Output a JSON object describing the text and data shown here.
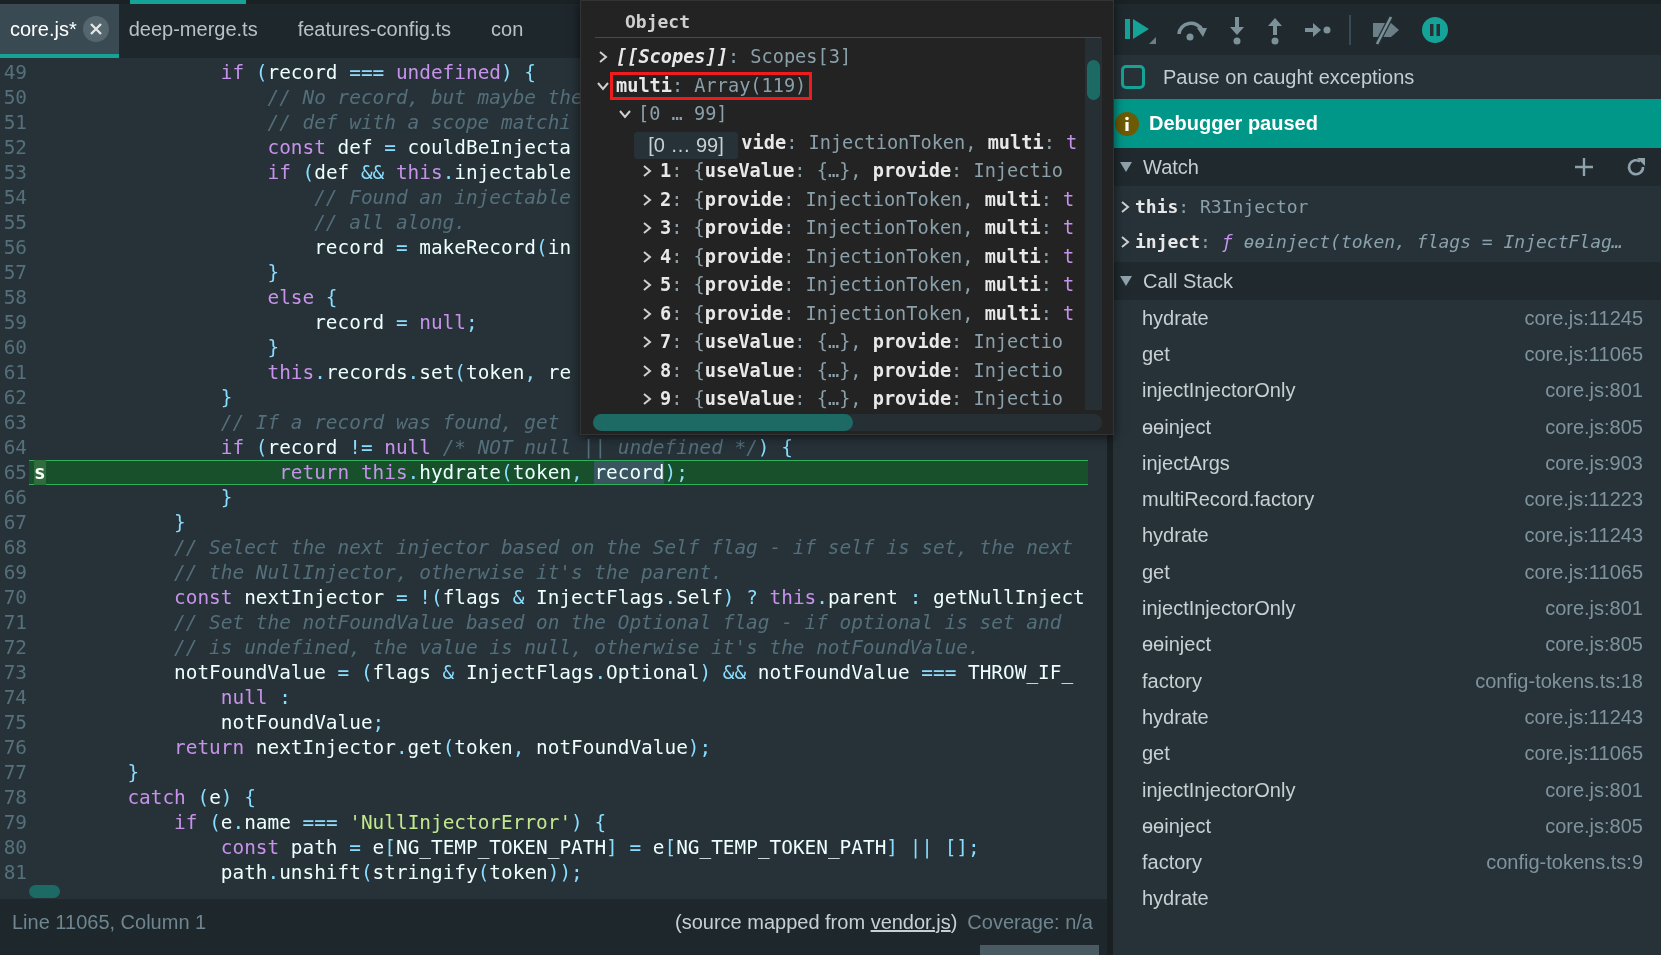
{
  "tabs": [
    {
      "label": "core.js*",
      "selected": true,
      "closable": true
    },
    {
      "label": "deep-merge.ts",
      "selected": false,
      "closable": false
    },
    {
      "label": "features-config.ts",
      "selected": false,
      "closable": false
    },
    {
      "label": "con",
      "selected": false,
      "closable": false
    }
  ],
  "editor": {
    "lines": [
      {
        "number": "49",
        "current": false,
        "segments": [
          {
            "t": "                if",
            "kind": "k"
          },
          {
            "t": " (",
            "kind": "o"
          },
          {
            "t": "record",
            "kind": "p"
          },
          {
            "t": " === ",
            "kind": "o"
          },
          {
            "t": "undefined",
            "kind": "k"
          },
          {
            "t": ") {",
            "kind": "o"
          }
        ]
      },
      {
        "number": "50",
        "current": false,
        "segments": [
          {
            "t": "                    // No record, but maybe the",
            "kind": "c"
          }
        ]
      },
      {
        "number": "51",
        "current": false,
        "segments": [
          {
            "t": "                    // def with a scope matchi",
            "kind": "c"
          }
        ]
      },
      {
        "number": "52",
        "current": false,
        "segments": [
          {
            "t": "                    const",
            "kind": "k"
          },
          {
            "t": " def ",
            "kind": "p"
          },
          {
            "t": "=",
            "kind": "o"
          },
          {
            "t": " couldBeInjecta",
            "kind": "p"
          }
        ]
      },
      {
        "number": "53",
        "current": false,
        "segments": [
          {
            "t": "                    if",
            "kind": "k"
          },
          {
            "t": " (",
            "kind": "o"
          },
          {
            "t": "def ",
            "kind": "p"
          },
          {
            "t": "&&",
            "kind": "o"
          },
          {
            "t": " this",
            "kind": "k"
          },
          {
            "t": ".",
            "kind": "o"
          },
          {
            "t": "injectable",
            "kind": "p"
          }
        ]
      },
      {
        "number": "54",
        "current": false,
        "segments": [
          {
            "t": "                        // Found an injectable",
            "kind": "c"
          }
        ]
      },
      {
        "number": "55",
        "current": false,
        "segments": [
          {
            "t": "                        // all along.",
            "kind": "c"
          }
        ]
      },
      {
        "number": "56",
        "current": false,
        "segments": [
          {
            "t": "                        record ",
            "kind": "p"
          },
          {
            "t": "=",
            "kind": "o"
          },
          {
            "t": " makeRecord",
            "kind": "p"
          },
          {
            "t": "(",
            "kind": "o"
          },
          {
            "t": "in",
            "kind": "p"
          }
        ]
      },
      {
        "number": "57",
        "current": false,
        "segments": [
          {
            "t": "                    }",
            "kind": "o"
          }
        ]
      },
      {
        "number": "58",
        "current": false,
        "segments": [
          {
            "t": "                    else",
            "kind": "k"
          },
          {
            "t": " {",
            "kind": "o"
          }
        ]
      },
      {
        "number": "59",
        "current": false,
        "segments": [
          {
            "t": "                        record ",
            "kind": "p"
          },
          {
            "t": "=",
            "kind": "o"
          },
          {
            "t": " null",
            "kind": "k"
          },
          {
            "t": ";",
            "kind": "o"
          }
        ]
      },
      {
        "number": "60",
        "current": false,
        "segments": [
          {
            "t": "                    }",
            "kind": "o"
          }
        ]
      },
      {
        "number": "61",
        "current": false,
        "segments": [
          {
            "t": "                    this",
            "kind": "k"
          },
          {
            "t": ".",
            "kind": "o"
          },
          {
            "t": "records",
            "kind": "p"
          },
          {
            "t": ".",
            "kind": "o"
          },
          {
            "t": "set",
            "kind": "p"
          },
          {
            "t": "(",
            "kind": "o"
          },
          {
            "t": "token",
            "kind": "p"
          },
          {
            "t": ", ",
            "kind": "o"
          },
          {
            "t": "re",
            "kind": "p"
          }
        ]
      },
      {
        "number": "62",
        "current": false,
        "segments": [
          {
            "t": "                }",
            "kind": "o"
          }
        ]
      },
      {
        "number": "63",
        "current": false,
        "segments": [
          {
            "t": "                // If a record was found, get",
            "kind": "c"
          }
        ]
      },
      {
        "number": "64",
        "current": false,
        "segments": [
          {
            "t": "                if",
            "kind": "k"
          },
          {
            "t": " (",
            "kind": "o"
          },
          {
            "t": "record ",
            "kind": "p"
          },
          {
            "t": "!=",
            "kind": "o"
          },
          {
            "t": " null",
            "kind": "k"
          },
          {
            "t": " /* NOT null || undefined */",
            "kind": "c"
          },
          {
            "t": ") {",
            "kind": "o"
          }
        ]
      },
      {
        "number": "65",
        "current": true,
        "marker": "s",
        "segments": [
          {
            "t": "                    return",
            "kind": "k"
          },
          {
            "t": " this",
            "kind": "k"
          },
          {
            "t": ".",
            "kind": "o"
          },
          {
            "t": "hydrate",
            "kind": "p"
          },
          {
            "t": "(",
            "kind": "o"
          },
          {
            "t": "token",
            "kind": "p"
          },
          {
            "t": ", ",
            "kind": "o"
          },
          {
            "t": "record",
            "kind": "sel"
          },
          {
            "t": ");",
            "kind": "o"
          }
        ]
      },
      {
        "number": "66",
        "current": false,
        "segments": [
          {
            "t": "                }",
            "kind": "o"
          }
        ]
      },
      {
        "number": "67",
        "current": false,
        "segments": [
          {
            "t": "            }",
            "kind": "o"
          }
        ]
      },
      {
        "number": "68",
        "current": false,
        "segments": [
          {
            "t": "            // Select the next injector based on the Self flag - if self is set, the next",
            "kind": "c"
          }
        ]
      },
      {
        "number": "69",
        "current": false,
        "segments": [
          {
            "t": "            // the NullInjector, otherwise it's the parent.",
            "kind": "c"
          }
        ]
      },
      {
        "number": "70",
        "current": false,
        "segments": [
          {
            "t": "            const",
            "kind": "k"
          },
          {
            "t": " nextInjector ",
            "kind": "p"
          },
          {
            "t": "= !(",
            "kind": "o"
          },
          {
            "t": "flags ",
            "kind": "p"
          },
          {
            "t": "&",
            "kind": "o"
          },
          {
            "t": " InjectFlags",
            "kind": "p"
          },
          {
            "t": ".",
            "kind": "o"
          },
          {
            "t": "Self",
            "kind": "p"
          },
          {
            "t": ") ? ",
            "kind": "o"
          },
          {
            "t": "this",
            "kind": "k"
          },
          {
            "t": ".",
            "kind": "o"
          },
          {
            "t": "parent ",
            "kind": "p"
          },
          {
            "t": ": ",
            "kind": "o"
          },
          {
            "t": "getNullInject",
            "kind": "p"
          }
        ]
      },
      {
        "number": "71",
        "current": false,
        "segments": [
          {
            "t": "            // Set the notFoundValue based on the Optional flag - if optional is set and",
            "kind": "c"
          }
        ]
      },
      {
        "number": "72",
        "current": false,
        "segments": [
          {
            "t": "            // is undefined, the value is null, otherwise it's the notFoundValue.",
            "kind": "c"
          }
        ]
      },
      {
        "number": "73",
        "current": false,
        "segments": [
          {
            "t": "            notFoundValue ",
            "kind": "p"
          },
          {
            "t": "= (",
            "kind": "o"
          },
          {
            "t": "flags ",
            "kind": "p"
          },
          {
            "t": "&",
            "kind": "o"
          },
          {
            "t": " InjectFlags",
            "kind": "p"
          },
          {
            "t": ".",
            "kind": "o"
          },
          {
            "t": "Optional",
            "kind": "p"
          },
          {
            "t": ") && ",
            "kind": "o"
          },
          {
            "t": "notFoundValue ",
            "kind": "p"
          },
          {
            "t": "===",
            "kind": "o"
          },
          {
            "t": " THROW_IF_",
            "kind": "p"
          }
        ]
      },
      {
        "number": "74",
        "current": false,
        "segments": [
          {
            "t": "                null",
            "kind": "k"
          },
          {
            "t": " :",
            "kind": "o"
          }
        ]
      },
      {
        "number": "75",
        "current": false,
        "segments": [
          {
            "t": "                notFoundValue",
            "kind": "p"
          },
          {
            "t": ";",
            "kind": "o"
          }
        ]
      },
      {
        "number": "76",
        "current": false,
        "segments": [
          {
            "t": "            return",
            "kind": "k"
          },
          {
            "t": " nextInjector",
            "kind": "p"
          },
          {
            "t": ".",
            "kind": "o"
          },
          {
            "t": "get",
            "kind": "p"
          },
          {
            "t": "(",
            "kind": "o"
          },
          {
            "t": "token",
            "kind": "p"
          },
          {
            "t": ", ",
            "kind": "o"
          },
          {
            "t": "notFoundValue",
            "kind": "p"
          },
          {
            "t": ");",
            "kind": "o"
          }
        ]
      },
      {
        "number": "77",
        "current": false,
        "segments": [
          {
            "t": "        }",
            "kind": "o"
          }
        ]
      },
      {
        "number": "78",
        "current": false,
        "segments": [
          {
            "t": "        catch",
            "kind": "k"
          },
          {
            "t": " (",
            "kind": "o"
          },
          {
            "t": "e",
            "kind": "p"
          },
          {
            "t": ") {",
            "kind": "o"
          }
        ]
      },
      {
        "number": "79",
        "current": false,
        "segments": [
          {
            "t": "            if",
            "kind": "k"
          },
          {
            "t": " (",
            "kind": "o"
          },
          {
            "t": "e",
            "kind": "p"
          },
          {
            "t": ".",
            "kind": "o"
          },
          {
            "t": "name ",
            "kind": "p"
          },
          {
            "t": "===",
            "kind": "o"
          },
          {
            "t": " 'NullInjectorError'",
            "kind": "s"
          },
          {
            "t": ") {",
            "kind": "o"
          }
        ]
      },
      {
        "number": "80",
        "current": false,
        "segments": [
          {
            "t": "                const",
            "kind": "k"
          },
          {
            "t": " path ",
            "kind": "p"
          },
          {
            "t": "=",
            "kind": "o"
          },
          {
            "t": " e",
            "kind": "p"
          },
          {
            "t": "[",
            "kind": "o"
          },
          {
            "t": "NG_TEMP_TOKEN_PATH",
            "kind": "p"
          },
          {
            "t": "] = ",
            "kind": "o"
          },
          {
            "t": "e",
            "kind": "p"
          },
          {
            "t": "[",
            "kind": "o"
          },
          {
            "t": "NG_TEMP_TOKEN_PATH",
            "kind": "p"
          },
          {
            "t": "] || [];",
            "kind": "o"
          }
        ]
      },
      {
        "number": "81",
        "current": false,
        "segments": [
          {
            "t": "                path",
            "kind": "p"
          },
          {
            "t": ".",
            "kind": "o"
          },
          {
            "t": "unshift",
            "kind": "p"
          },
          {
            "t": "(",
            "kind": "o"
          },
          {
            "t": "stringify",
            "kind": "p"
          },
          {
            "t": "(",
            "kind": "o"
          },
          {
            "t": "token",
            "kind": "p"
          },
          {
            "t": "));",
            "kind": "o"
          }
        ]
      }
    ]
  },
  "popup": {
    "title": "Object",
    "tooltip": "[0 … 99]",
    "tree": [
      {
        "kind": "entry",
        "expanded": false,
        "highlighted": false,
        "segments": [
          {
            "t": "[[Scopes]]",
            "kind": "ikey"
          },
          {
            "t": ": Scopes[3]",
            "kind": "val"
          }
        ]
      },
      {
        "kind": "entry",
        "expanded": true,
        "highlighted": true,
        "segments": [
          {
            "t": "multi",
            "kind": "key"
          },
          {
            "t": ": Array(119)",
            "kind": "val"
          }
        ],
        "children": [
          {
            "kind": "entry",
            "expanded": true,
            "highlighted": false,
            "segments": [
              {
                "t": "[0 … 99]",
                "kind": "val"
              }
            ],
            "children": [
              {
                "kind": "covered",
                "segments": [
                  {
                    "t": "vide",
                    "kind": "key"
                  },
                  {
                    "t": ": InjectionToken, ",
                    "kind": "val"
                  },
                  {
                    "t": "multi",
                    "kind": "key"
                  },
                  {
                    "t": ": ",
                    "kind": "val"
                  },
                  {
                    "t": "t",
                    "kind": "bool"
                  }
                ]
              },
              {
                "kind": "entry",
                "expanded": false,
                "segments": [
                  {
                    "t": "1",
                    "kind": "key"
                  },
                  {
                    "t": ": {",
                    "kind": "val"
                  },
                  {
                    "t": "useValue",
                    "kind": "key"
                  },
                  {
                    "t": ": {…}, ",
                    "kind": "val"
                  },
                  {
                    "t": "provide",
                    "kind": "key"
                  },
                  {
                    "t": ": Injectio",
                    "kind": "val"
                  }
                ]
              },
              {
                "kind": "entry",
                "expanded": false,
                "segments": [
                  {
                    "t": "2",
                    "kind": "key"
                  },
                  {
                    "t": ": {",
                    "kind": "val"
                  },
                  {
                    "t": "provide",
                    "kind": "key"
                  },
                  {
                    "t": ": InjectionToken, ",
                    "kind": "val"
                  },
                  {
                    "t": "multi",
                    "kind": "key"
                  },
                  {
                    "t": ": ",
                    "kind": "val"
                  },
                  {
                    "t": "t",
                    "kind": "bool"
                  }
                ]
              },
              {
                "kind": "entry",
                "expanded": false,
                "segments": [
                  {
                    "t": "3",
                    "kind": "key"
                  },
                  {
                    "t": ": {",
                    "kind": "val"
                  },
                  {
                    "t": "provide",
                    "kind": "key"
                  },
                  {
                    "t": ": InjectionToken, ",
                    "kind": "val"
                  },
                  {
                    "t": "multi",
                    "kind": "key"
                  },
                  {
                    "t": ": ",
                    "kind": "val"
                  },
                  {
                    "t": "t",
                    "kind": "bool"
                  }
                ]
              },
              {
                "kind": "entry",
                "expanded": false,
                "segments": [
                  {
                    "t": "4",
                    "kind": "key"
                  },
                  {
                    "t": ": {",
                    "kind": "val"
                  },
                  {
                    "t": "provide",
                    "kind": "key"
                  },
                  {
                    "t": ": InjectionToken, ",
                    "kind": "val"
                  },
                  {
                    "t": "multi",
                    "kind": "key"
                  },
                  {
                    "t": ": ",
                    "kind": "val"
                  },
                  {
                    "t": "t",
                    "kind": "bool"
                  }
                ]
              },
              {
                "kind": "entry",
                "expanded": false,
                "segments": [
                  {
                    "t": "5",
                    "kind": "key"
                  },
                  {
                    "t": ": {",
                    "kind": "val"
                  },
                  {
                    "t": "provide",
                    "kind": "key"
                  },
                  {
                    "t": ": InjectionToken, ",
                    "kind": "val"
                  },
                  {
                    "t": "multi",
                    "kind": "key"
                  },
                  {
                    "t": ": ",
                    "kind": "val"
                  },
                  {
                    "t": "t",
                    "kind": "bool"
                  }
                ]
              },
              {
                "kind": "entry",
                "expanded": false,
                "segments": [
                  {
                    "t": "6",
                    "kind": "key"
                  },
                  {
                    "t": ": {",
                    "kind": "val"
                  },
                  {
                    "t": "provide",
                    "kind": "key"
                  },
                  {
                    "t": ": InjectionToken, ",
                    "kind": "val"
                  },
                  {
                    "t": "multi",
                    "kind": "key"
                  },
                  {
                    "t": ": ",
                    "kind": "val"
                  },
                  {
                    "t": "t",
                    "kind": "bool"
                  }
                ]
              },
              {
                "kind": "entry",
                "expanded": false,
                "segments": [
                  {
                    "t": "7",
                    "kind": "key"
                  },
                  {
                    "t": ": {",
                    "kind": "val"
                  },
                  {
                    "t": "useValue",
                    "kind": "key"
                  },
                  {
                    "t": ": {…}, ",
                    "kind": "val"
                  },
                  {
                    "t": "provide",
                    "kind": "key"
                  },
                  {
                    "t": ": Injectio",
                    "kind": "val"
                  }
                ]
              },
              {
                "kind": "entry",
                "expanded": false,
                "segments": [
                  {
                    "t": "8",
                    "kind": "key"
                  },
                  {
                    "t": ": {",
                    "kind": "val"
                  },
                  {
                    "t": "useValue",
                    "kind": "key"
                  },
                  {
                    "t": ": {…}, ",
                    "kind": "val"
                  },
                  {
                    "t": "provide",
                    "kind": "key"
                  },
                  {
                    "t": ": Injectio",
                    "kind": "val"
                  }
                ]
              },
              {
                "kind": "entry",
                "expanded": false,
                "segments": [
                  {
                    "t": "9",
                    "kind": "key"
                  },
                  {
                    "t": ": {",
                    "kind": "val"
                  },
                  {
                    "t": "useValue",
                    "kind": "key"
                  },
                  {
                    "t": ": {…}, ",
                    "kind": "val"
                  },
                  {
                    "t": "provide",
                    "kind": "key"
                  },
                  {
                    "t": ": Injectio",
                    "kind": "val"
                  }
                ]
              }
            ]
          }
        ]
      }
    ]
  },
  "status_bar": {
    "position": "Line 11065, Column 1",
    "source_note": {
      "before": "(source mapped from ",
      "link": "vendor.js",
      "after": ")"
    },
    "coverage": "Coverage: n/a"
  },
  "debugger": {
    "pause_on_caught": {
      "label": "Pause on caught exceptions",
      "checked": false
    },
    "banner": "Debugger paused",
    "watch": {
      "title": "Watch",
      "expanded": true,
      "items": [
        {
          "expanded": false,
          "segments": [
            {
              "t": "this",
              "kind": "key"
            },
            {
              "t": ": R3Injector",
              "kind": "val"
            }
          ]
        },
        {
          "expanded": false,
          "segments": [
            {
              "t": "inject",
              "kind": "key"
            },
            {
              "t": ": ",
              "kind": "val"
            },
            {
              "t": "ƒ",
              "kind": "fn"
            },
            {
              "t": " ɵɵinject(token, flags = InjectFlag…",
              "kind": "ival"
            }
          ]
        }
      ]
    },
    "call_stack": {
      "title": "Call Stack",
      "expanded": true,
      "frames": [
        {
          "name": "hydrate",
          "location": "core.js:11245"
        },
        {
          "name": "get",
          "location": "core.js:11065"
        },
        {
          "name": "injectInjectorOnly",
          "location": "core.js:801"
        },
        {
          "name": "ɵɵinject",
          "location": "core.js:805"
        },
        {
          "name": "injectArgs",
          "location": "core.js:903"
        },
        {
          "name": "multiRecord.factory",
          "location": "core.js:11223"
        },
        {
          "name": "hydrate",
          "location": "core.js:11243"
        },
        {
          "name": "get",
          "location": "core.js:11065"
        },
        {
          "name": "injectInjectorOnly",
          "location": "core.js:801"
        },
        {
          "name": "ɵɵinject",
          "location": "core.js:805"
        },
        {
          "name": "factory",
          "location": "config-tokens.ts:18"
        },
        {
          "name": "hydrate",
          "location": "core.js:11243"
        },
        {
          "name": "get",
          "location": "core.js:11065"
        },
        {
          "name": "injectInjectorOnly",
          "location": "core.js:801"
        },
        {
          "name": "ɵɵinject",
          "location": "core.js:805"
        },
        {
          "name": "factory",
          "location": "config-tokens.ts:9"
        },
        {
          "name": "hydrate"
        }
      ]
    }
  }
}
